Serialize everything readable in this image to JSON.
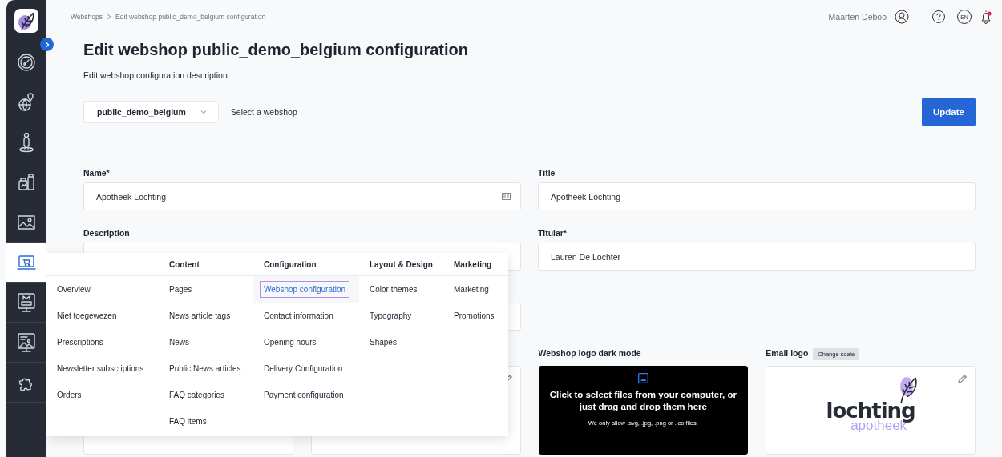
{
  "breadcrumb": [
    {
      "label": "Webshops"
    },
    {
      "label": "Edit webshop public_demo_belgium configuration"
    }
  ],
  "user": {
    "name": "Maarten Deboo",
    "language": "EN",
    "notification": true
  },
  "sidebar": {
    "items": [
      {
        "kind": "gauge",
        "selected": false
      },
      {
        "kind": "globe",
        "selected": false
      },
      {
        "kind": "person",
        "selected": false
      },
      {
        "kind": "bottles",
        "selected": false
      },
      {
        "kind": "image",
        "selected": false
      },
      {
        "kind": "cart",
        "selected": true
      },
      {
        "kind": "monitor",
        "selected": false
      },
      {
        "kind": "easel",
        "selected": false
      },
      {
        "kind": "puzzle",
        "selected": false
      }
    ]
  },
  "header": {
    "title": "Edit webshop public_demo_belgium configuration",
    "description": "Edit webshop configuration description."
  },
  "webshop_select": {
    "value": "public_demo_belgium",
    "hint": "Select a webshop"
  },
  "update_button": {
    "label": "Update"
  },
  "form": {
    "name": {
      "label": "Name*",
      "value": "Apotheek Lochting"
    },
    "title": {
      "label": "Title",
      "value": "Apotheek Lochting"
    },
    "description": {
      "label": "Description"
    },
    "titular": {
      "label": "Titular*",
      "value": "Lauren De Lochter"
    }
  },
  "uploads": [
    {
      "kind": "covered",
      "editable": false
    },
    {
      "kind": "covered",
      "editable": true
    },
    {
      "kind": "dropzone",
      "editable": false,
      "label": "Webshop logo dark mode",
      "prompt": "Click to select files from your computer, or just drag and drop them here",
      "note": "We only allow .svg, .jpg, .png or .ico files."
    },
    {
      "kind": "logo",
      "editable": true,
      "label": "Email logo",
      "action": "Change scale",
      "logo_word": "lochting",
      "logo_subtitle": "apotheek"
    }
  ],
  "menu": {
    "columns": [
      {
        "items": [
          {
            "label": "Overview",
            "selected": false
          },
          {
            "label": "Niet toegewezen",
            "selected": false
          },
          {
            "label": "Prescriptions",
            "selected": false
          },
          {
            "label": "Newsletter subscriptions",
            "selected": false
          },
          {
            "label": "Orders",
            "selected": false
          }
        ]
      },
      {
        "heading": "Content",
        "items": [
          {
            "label": "Pages",
            "selected": false
          },
          {
            "label": "News article tags",
            "selected": false
          },
          {
            "label": "News",
            "selected": false
          },
          {
            "label": "Public News articles",
            "selected": false
          },
          {
            "label": "FAQ categories",
            "selected": false
          },
          {
            "label": "FAQ items",
            "selected": false
          }
        ]
      },
      {
        "heading": "Configuration",
        "items": [
          {
            "label": "Webshop configuration",
            "selected": true
          },
          {
            "label": "Contact information",
            "selected": false
          },
          {
            "label": "Opening hours",
            "selected": false
          },
          {
            "label": "Delivery Configuration",
            "selected": false
          },
          {
            "label": "Payment configuration",
            "selected": false
          }
        ]
      },
      {
        "heading": "Layout & Design",
        "items": [
          {
            "label": "Color themes",
            "selected": false
          },
          {
            "label": "Typography",
            "selected": false
          },
          {
            "label": "Shapes",
            "selected": false
          }
        ]
      },
      {
        "heading": "Marketing",
        "items": [
          {
            "label": "Marketing",
            "selected": false
          },
          {
            "label": "Promotions",
            "selected": false
          }
        ]
      }
    ]
  }
}
